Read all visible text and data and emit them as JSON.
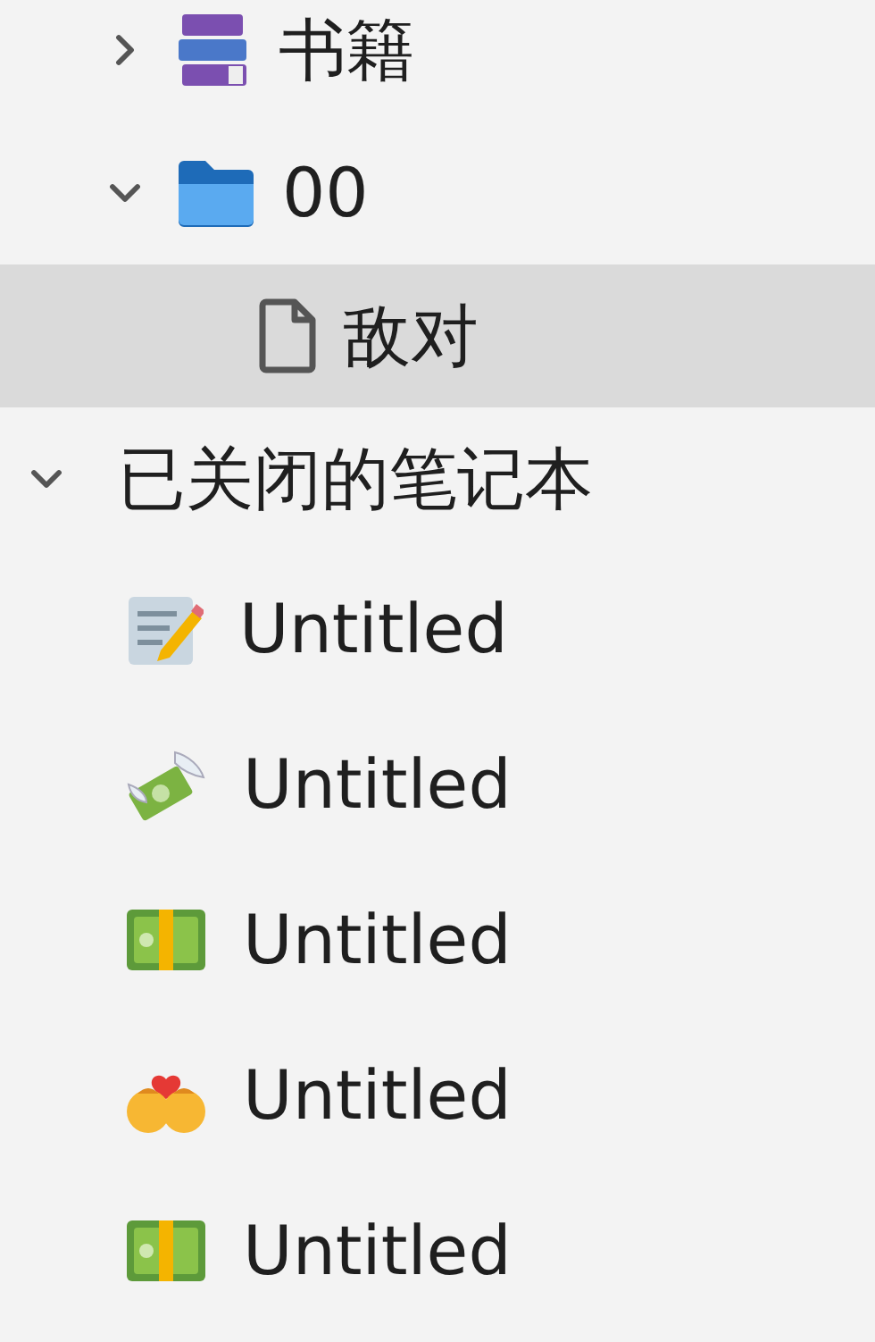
{
  "tree": [
    {
      "label": "书籍",
      "kind": "books",
      "expanded": false,
      "selected": false
    },
    {
      "label": "00",
      "kind": "folder",
      "expanded": true,
      "selected": false,
      "children": [
        {
          "label": "敌对",
          "kind": "file",
          "selected": true
        }
      ]
    }
  ],
  "closed_section": {
    "title": "已关闭的笔记本",
    "expanded": true,
    "items": [
      {
        "label": "Untitled",
        "kind": "memo"
      },
      {
        "label": "Untitled",
        "kind": "money-wings"
      },
      {
        "label": "Untitled",
        "kind": "banknote"
      },
      {
        "label": "Untitled",
        "kind": "kiss"
      },
      {
        "label": "Untitled",
        "kind": "banknote"
      }
    ]
  }
}
